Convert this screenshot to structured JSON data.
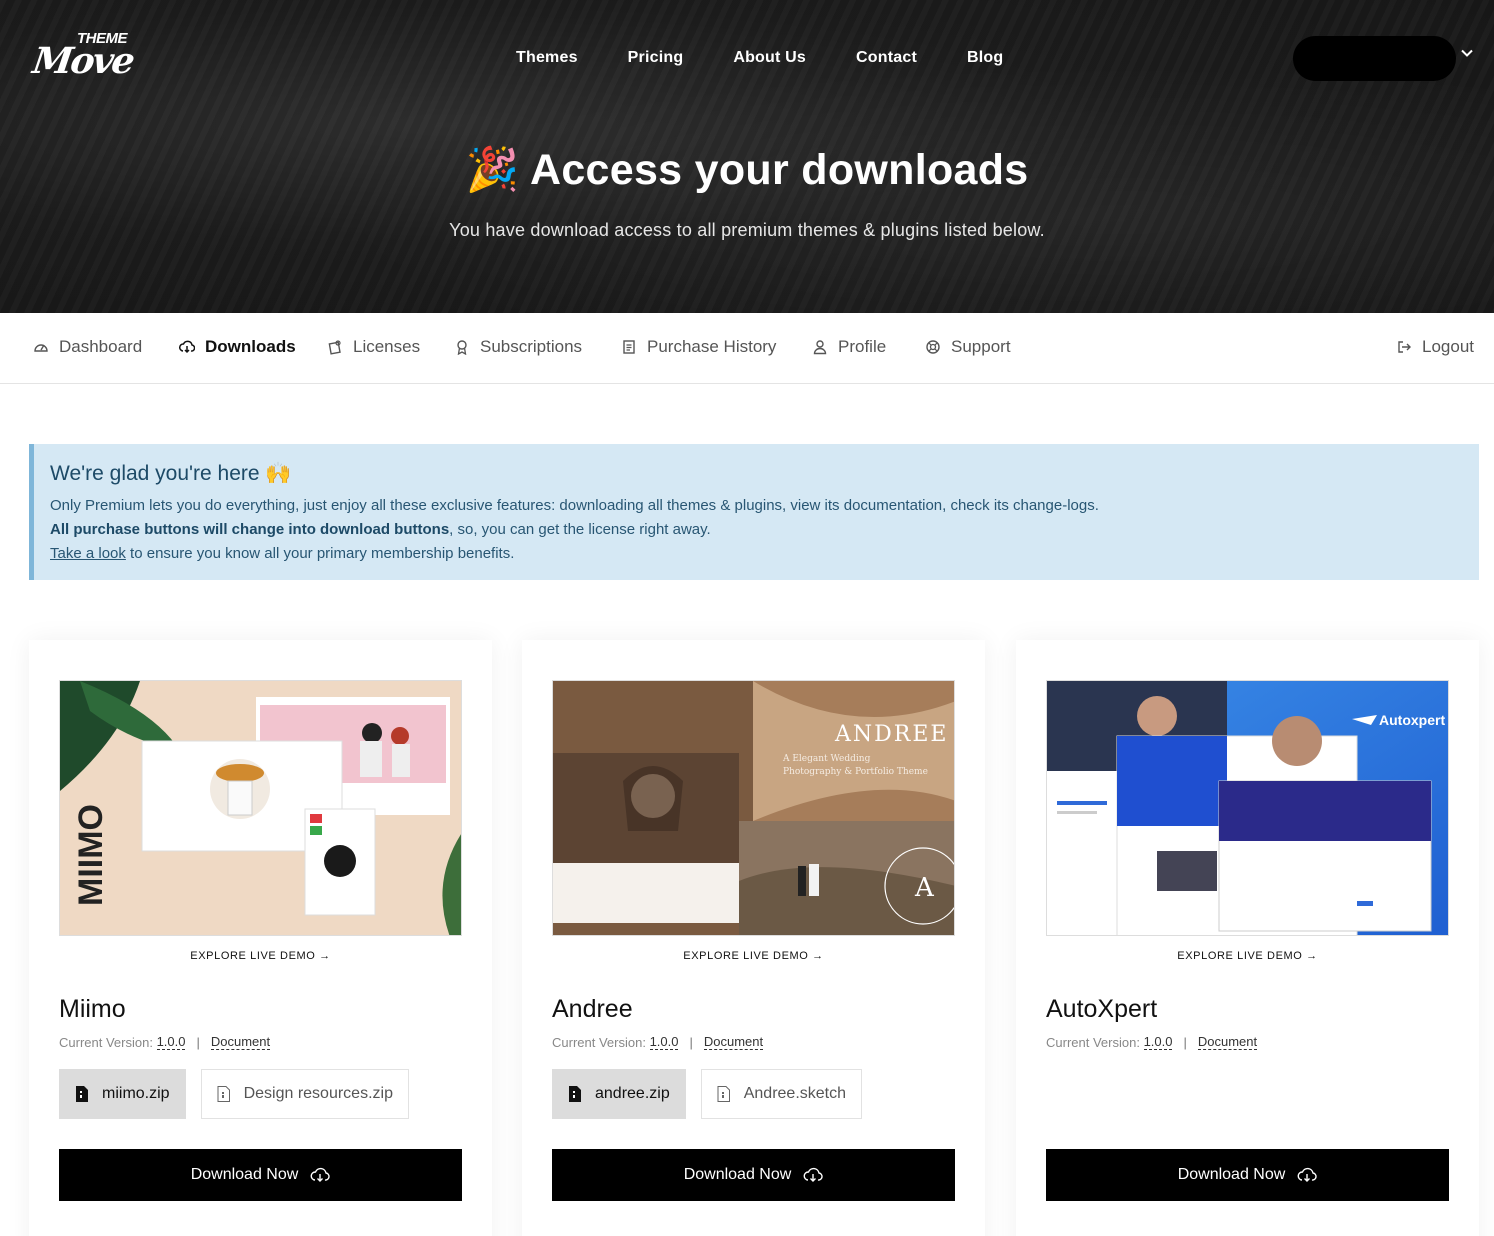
{
  "brand": {
    "logo_top": "THEME",
    "logo_main": "Move"
  },
  "nav": [
    "Themes",
    "Pricing",
    "About Us",
    "Contact",
    "Blog"
  ],
  "hero": {
    "emoji": "🎉",
    "title": "Access your downloads",
    "subtitle": "You have download access to all premium themes & plugins listed below."
  },
  "tabs": [
    {
      "label": "Dashboard",
      "icon": "dashboard-icon"
    },
    {
      "label": "Downloads",
      "icon": "cloud-download-icon",
      "active": true
    },
    {
      "label": "Licenses",
      "icon": "license-icon"
    },
    {
      "label": "Subscriptions",
      "icon": "badge-icon"
    },
    {
      "label": "Purchase History",
      "icon": "receipt-icon"
    },
    {
      "label": "Profile",
      "icon": "user-icon"
    },
    {
      "label": "Support",
      "icon": "lifebuoy-icon"
    }
  ],
  "logout": "Logout",
  "notice": {
    "title": "We're glad you're here 🙌",
    "line1": "Only Premium lets you do everything, just enjoy all these exclusive features: downloading all themes & plugins, view its documentation, check its change-logs.",
    "line2_bold": "All purchase buttons will change into download buttons",
    "line2_rest": ", so, you can get the license right away.",
    "line3_link": "Take a look",
    "line3_rest": " to ensure you know all your primary membership benefits."
  },
  "cards": [
    {
      "title": "Miimo",
      "demo": "EXPLORE LIVE DEMO →",
      "version_label": "Current Version:",
      "version": "1.0.0",
      "doc": "Document",
      "files": [
        "miimo.zip",
        "Design resources.zip"
      ],
      "button": "Download Now"
    },
    {
      "title": "Andree",
      "demo": "EXPLORE LIVE DEMO →",
      "version_label": "Current Version:",
      "version": "1.0.0",
      "doc": "Document",
      "files": [
        "andree.zip",
        "Andree.sketch"
      ],
      "button": "Download Now",
      "thumb_title": "ANDREE",
      "thumb_sub1": "A Elegant Wedding",
      "thumb_sub2": "Photography & Portfolio Theme"
    },
    {
      "title": "AutoXpert",
      "demo": "EXPLORE LIVE DEMO →",
      "version_label": "Current Version:",
      "version": "1.0.0",
      "doc": "Document",
      "files": [],
      "button": "Download Now",
      "thumb_brand": "Autoxpert"
    }
  ],
  "colors": {
    "hero_bg": "#1c1c1c",
    "notice_bg": "#d5e8f4",
    "button_bg": "#000000"
  }
}
